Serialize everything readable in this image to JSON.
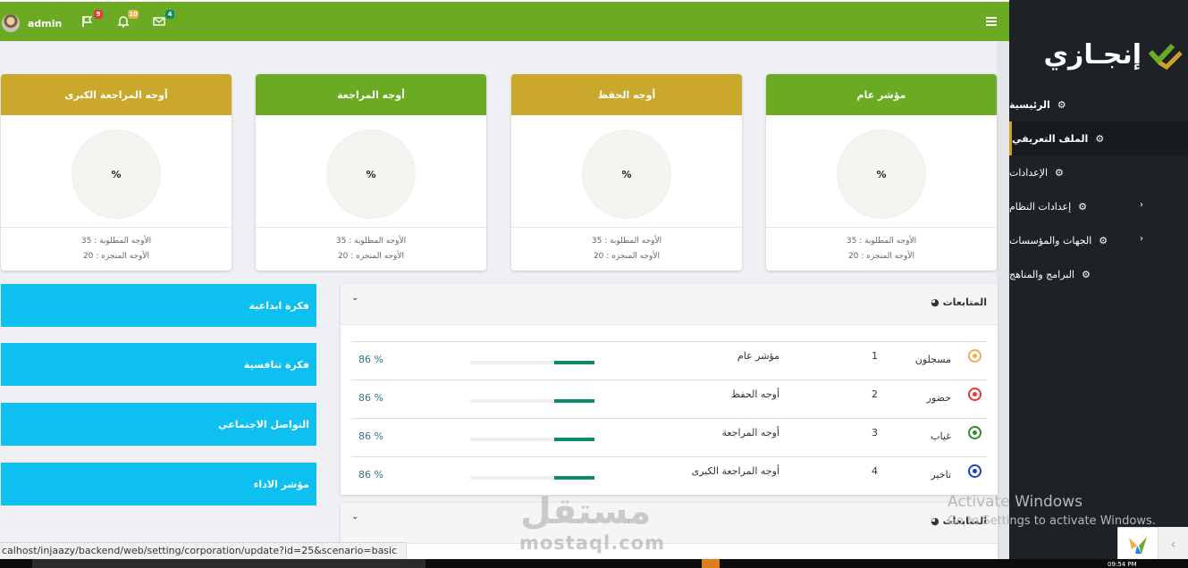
{
  "header": {
    "username": "admin",
    "flag_badge": "9",
    "bell_badge": "10",
    "mail_badge": "4",
    "colors": {
      "bar": "#6aab23",
      "flag_badge": "#e53935",
      "bell_badge": "#f0ad4e",
      "mail_badge": "#0e8a6c"
    }
  },
  "sidebar": {
    "brand": "إنجـازي",
    "items": [
      {
        "label": "الرئيسية"
      },
      {
        "label": "الملف التعريفي"
      },
      {
        "label": "الإعدادات"
      },
      {
        "label": "إعدادات النظام"
      },
      {
        "label": "الجهات والمؤسسات"
      },
      {
        "label": "البرامج والمناهج"
      }
    ]
  },
  "cards": [
    {
      "title": "أوجه المراجعة الكبرى",
      "value": "%",
      "required": "الأوجه المطلوبة : 35",
      "done": "الأوجه المنجزه : 20",
      "color": "#c9a82c"
    },
    {
      "title": "أوجه المراجعة",
      "value": "%",
      "required": "الأوجه المطلوبة : 35",
      "done": "الأوجه المنجزه : 20",
      "color": "#6aab23"
    },
    {
      "title": "أوجه الحفظ",
      "value": "%",
      "required": "الأوجه المطلوبة : 35",
      "done": "الأوجه المنجزه : 20",
      "color": "#c9a82c"
    },
    {
      "title": "مؤشر عام",
      "value": "%",
      "required": "الأوجه المطلوبة : 35",
      "done": "الأوجه المنجزه : 20",
      "color": "#6aab23"
    }
  ],
  "side_buttons": [
    "فكرة ابداعية",
    "فكرة تنافسية",
    "التواصل الاجتماعي",
    "مؤشر الاداء"
  ],
  "panel": {
    "title": "المتابعات",
    "rows": [
      {
        "status": "مسجلون",
        "num": "1",
        "name": "مؤشر عام",
        "percent": "86 %",
        "progress": 0.32,
        "dot_color": "#f0ad4e"
      },
      {
        "status": "حضور",
        "num": "2",
        "name": "أوجه الحفظ",
        "percent": "86 %",
        "progress": 0.32,
        "dot_color": "#e53935"
      },
      {
        "status": "غياب",
        "num": "3",
        "name": "أوجه المراجعة",
        "percent": "86 %",
        "progress": 0.32,
        "dot_color": "#2e8b2e"
      },
      {
        "status": "تاخير",
        "num": "4",
        "name": "أوجه المراجعة الكبرى",
        "percent": "86 %",
        "progress": 0.32,
        "dot_color": "#1e3fc0"
      }
    ]
  },
  "panel2": {
    "title": "المتابعات"
  },
  "status_bar": {
    "url": "calhost/injaazy/backend/web/setting/corporation/update?id=25&scenario=basic"
  },
  "overlay": {
    "activate_title": "Activate Windows",
    "activate_sub": "Go to Settings to activate Windows.",
    "watermark_logo": "مستقل",
    "watermark_site": "mostaql.com",
    "clock": "09:54 PM"
  }
}
